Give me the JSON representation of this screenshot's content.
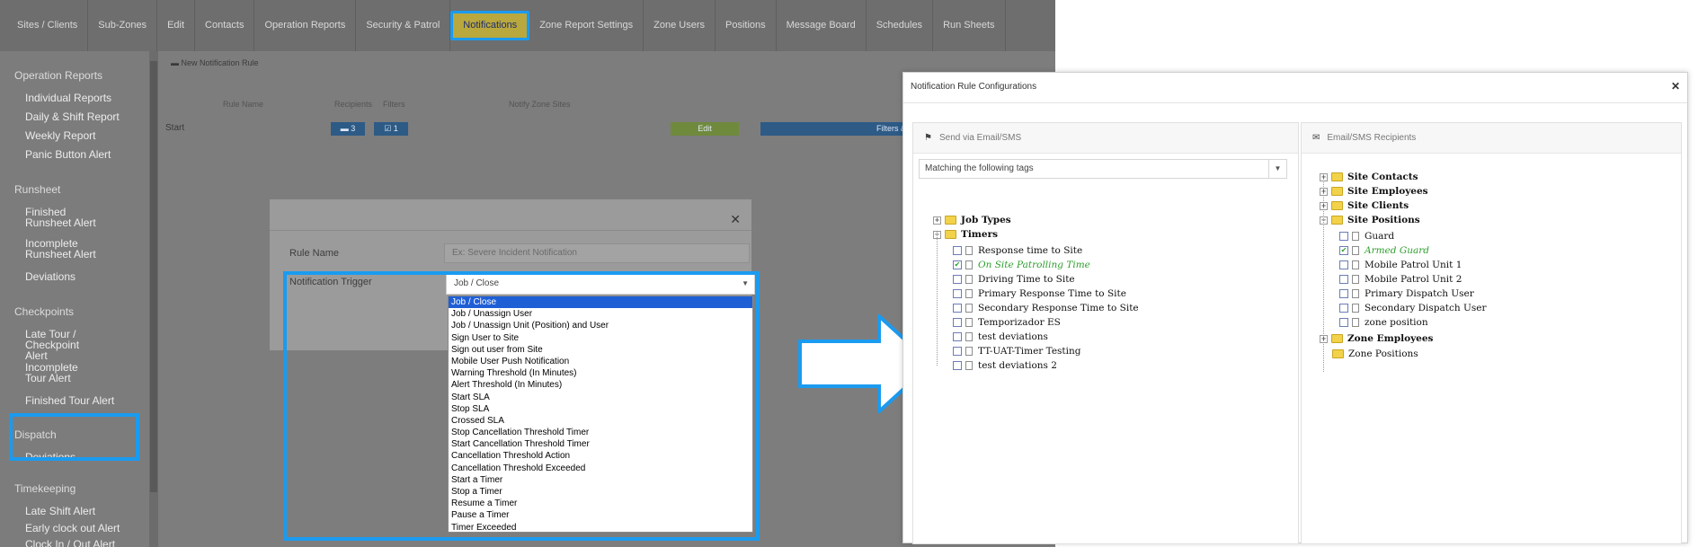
{
  "topnav": {
    "items": [
      "Sites / Clients",
      "Sub-Zones",
      "Edit",
      "Contacts",
      "Operation Reports",
      "Security & Patrol",
      "Notifications",
      "Zone Report Settings",
      "Zone Users",
      "Positions",
      "Message Board",
      "Schedules",
      "Run Sheets"
    ],
    "active": "Notifications"
  },
  "sidebar": {
    "sections": [
      {
        "label": "Operation Reports",
        "items": [
          "Individual Reports",
          "Daily & Shift Report",
          "Weekly Report",
          "Panic Button Alert"
        ]
      },
      {
        "label": "Runsheet",
        "items": [
          "Finished Runsheet Alert",
          "Incomplete Runsheet Alert",
          "Deviations"
        ]
      },
      {
        "label": "Checkpoints",
        "items": [
          "Late Tour / Checkpoint Alert",
          "Incomplete Tour Alert",
          "Finished Tour Alert"
        ]
      },
      {
        "label": "Dispatch",
        "items": [
          "Deviations"
        ]
      },
      {
        "label": "Timekeeping",
        "items": [
          "Late Shift Alert",
          "Early clock out Alert",
          "Clock In / Out Alert"
        ]
      }
    ]
  },
  "content": {
    "new_rule": "New Notification Rule",
    "headers": {
      "rule_name": "Rule Name",
      "recipients": "Recipients",
      "filters": "Filters",
      "notify": "Notify Zone Sites"
    },
    "row": {
      "name": "Start",
      "recipients_count": "3",
      "filters_count": "1",
      "edit_label": "Edit",
      "filters_label": "Filters &"
    }
  },
  "modal": {
    "rule_name_label": "Rule Name",
    "rule_name_placeholder": "Ex: Severe Incident Notification",
    "trigger_label": "Notification Trigger",
    "trigger_value": "Job / Close",
    "options": [
      "Job / Close",
      "Job / Unassign User",
      "Job / Unassign Unit (Position) and User",
      "Sign User to Site",
      "Sign out user from Site",
      "Mobile User Push Notification",
      "Warning Threshold (In Minutes)",
      "Alert Threshold (In Minutes)",
      "Start SLA",
      "Stop SLA",
      "Crossed SLA",
      "Stop Cancellation Threshold Timer",
      "Start Cancellation Threshold Timer",
      "Cancellation Threshold Action",
      "Cancellation Threshold Exceeded",
      "Start a Timer",
      "Stop a Timer",
      "Resume a Timer",
      "Pause a Timer",
      "Timer Exceeded"
    ],
    "selected_option": "Job / Close"
  },
  "dialog": {
    "title": "Notification Rule Configurations",
    "left_panel": {
      "header": "Send via Email/SMS",
      "tags_select": "Matching the following tags",
      "tree": {
        "job_types": "Job Types",
        "timers": "Timers",
        "timer_children": [
          {
            "label": "Response time to Site",
            "checked": false
          },
          {
            "label": "On Site Patrolling Time",
            "checked": true
          },
          {
            "label": "Driving Time to Site",
            "checked": false
          },
          {
            "label": "Primary Response Time to Site",
            "checked": false
          },
          {
            "label": "Secondary Response Time to Site",
            "checked": false
          },
          {
            "label": "Temporizador ES",
            "checked": false
          },
          {
            "label": "test deviations",
            "checked": false
          },
          {
            "label": "TT-UAT-Timer Testing",
            "checked": false
          },
          {
            "label": "test deviations 2",
            "checked": false
          }
        ]
      }
    },
    "right_panel": {
      "header": "Email/SMS Recipients",
      "tree": {
        "site_contacts": "Site Contacts",
        "site_employees": "Site Employees",
        "site_clients": "Site Clients",
        "site_positions": "Site Positions",
        "position_children": [
          {
            "label": "Guard",
            "checked": false
          },
          {
            "label": "Armed Guard",
            "checked": true
          },
          {
            "label": "Mobile Patrol Unit 1",
            "checked": false
          },
          {
            "label": "Mobile Patrol Unit 2",
            "checked": false
          },
          {
            "label": "Primary Dispatch User",
            "checked": false
          },
          {
            "label": "Secondary Dispatch User",
            "checked": false
          },
          {
            "label": "zone position",
            "checked": false
          }
        ],
        "zone_employees": "Zone Employees",
        "zone_positions": "Zone Positions"
      }
    }
  },
  "colors": {
    "highlight": "#1a9bf0",
    "checked_text": "#2e9e2e",
    "selected_node": "#2b5fd0",
    "arrow": "#1a9bf0"
  }
}
